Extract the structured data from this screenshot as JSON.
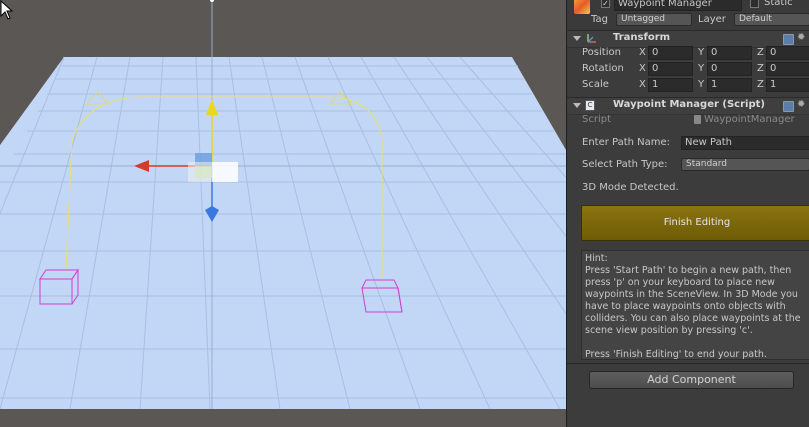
{
  "header": {
    "object_name": "Waypoint Manager",
    "static_label": "Static",
    "tag_label": "Tag",
    "tag_value": "Untagged",
    "layer_label": "Layer",
    "layer_value": "Default"
  },
  "transform": {
    "title": "Transform",
    "rows": [
      {
        "label": "Position",
        "x": "0",
        "y": "0",
        "z": "0"
      },
      {
        "label": "Rotation",
        "x": "0",
        "y": "0",
        "z": "0"
      },
      {
        "label": "Scale",
        "x": "1",
        "y": "1",
        "z": "1"
      }
    ],
    "axis_x": "X",
    "axis_y": "Y",
    "axis_z": "Z"
  },
  "script_component": {
    "title": "Waypoint Manager (Script)",
    "script_label": "Script",
    "script_value": "WaypointManager",
    "path_name_label": "Enter Path Name:",
    "path_name_value": "New Path",
    "path_type_label": "Select Path Type:",
    "path_type_value": "Standard",
    "mode_text": "3D Mode Detected.",
    "finish_button": "Finish Editing",
    "hint_title": "Hint:",
    "hint_body": "Press 'Start Path' to begin a new path, then press 'p' on your keyboard to place new waypoints in the SceneView. In 3D Mode you have to place waypoints onto objects with colliders. You can also place waypoints at the scene view position by pressing 'c'.",
    "hint_footer": "Press 'Finish Editing' to end your path."
  },
  "add_component": "Add Component",
  "colors": {
    "finish_button": "#7d690c",
    "plane": "#c2d6f5",
    "waypoint_gizmo": "#d040d0",
    "path_line": "#e8e070",
    "axis_x": "#d83a2a",
    "axis_y": "#e8d820",
    "axis_z": "#3a78e0"
  }
}
